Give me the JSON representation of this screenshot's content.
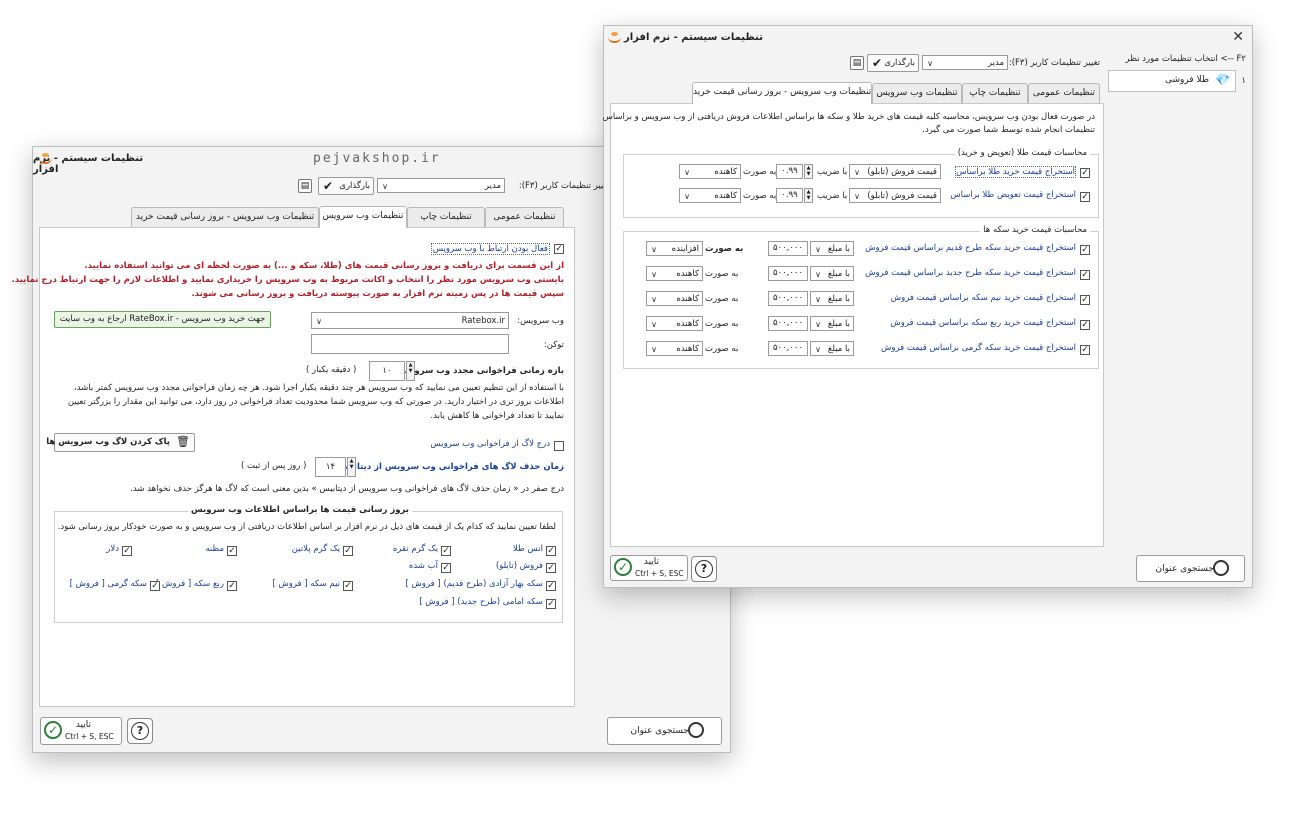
{
  "watermark": "pejvakshop.ir",
  "back": {
    "title": "تنظیمات سیستم - نرم افزار",
    "user_settings_label": "تغییر تنظیمات کاربر (F۳):",
    "user_value": "مدیر",
    "load_label": "بارگذاری",
    "tabs": [
      "تنظیمات عمومی",
      "تنظیمات چاپ",
      "تنظیمات وب سرویس",
      "تنظیمات وب سرویس - بروز رسانی قیمت خرید"
    ],
    "enable_label": "فعال بودن ارتباط با وب سرویس",
    "red_lines": [
      "از این قسمت برای دریافت و بروز رسانی قیمت های (طلا، سکه و ...) به صورت لحظه ای می توانید استفاده نمایید.",
      "بایستی وب سرویس مورد نظر را انتخاب و اکانت مربوط به وب سرویس را خریداری نمایید و اطلاعات لازم را جهت ارتباط درج نمایید.",
      "سپس قیمت ها در پس زمینه نرم افزار به صورت پیوسته دریافت و بروز رسانی می شوند."
    ],
    "webservice_label": "وب سرویس:",
    "webservice_value": "Ratebox.ir",
    "referral_button": "ارجاع به وب سایت RateBox.ir - جهت خرید وب سرویس",
    "token_label": "توکن:",
    "interval_label": "بازه زمانی فراخوانی مجدد وب سرویس:",
    "interval_value": "۱۰",
    "interval_unit": "( دقیقه یکبار )",
    "interval_desc": [
      "با استفاده از این تنظیم تعیین می نمایید که وب سرویس هر چند دقیقه یکبار اجرا شود. هر چه زمان فراخوانی مجدد وب سرویس کمتر باشد،",
      "اطلاعات بروز تری در اختیار دارید. در صورتی که وب سرویس شما محدودیت تعداد فراخوانی در روز دارد، می توانید این مقدار را بزرگتر تعیین",
      "نمایید تا تعداد فراخوانی ها کاهش یابد."
    ],
    "log_label": "درج لاگ از فراخوانی وب سرویس",
    "clear_log_button": "پاک کردن لاگ وب سرویس ها",
    "log_delete_label": "زمان حذف لاگ های فراخوانی وب سرویس از دیتابیس:",
    "log_delete_value": "۱۴",
    "log_delete_unit": "( روز پس از ثبت )",
    "log_delete_desc": "درج صفر در « زمان حذف لاگ های فراخوانی وب سرویس از دیتابیس » بدین معنی است که لاگ ها هرگز حذف نخواهد شد.",
    "group_title": "بروز رسانی قیمت ها براساس اطلاعات وب سرویس",
    "group_desc": "لطفا تعیین نمایید که کدام یک از قیمت های ذیل در نرم افزار بر اساس اطلاعات دریافتی از وب سرویس و به صورت خودکار بروز رسانی شود.",
    "items": [
      "انس طلا",
      "یک گرم نقره",
      "یک گرم پلاتین",
      "مظنه",
      "دلار",
      "فروش (تابلو)",
      "آب شده",
      "سکه بهار آزادی (طرح قدیم) [ فروش ]",
      "نیم سکه [ فروش ]",
      "ربع سکه [ فروش ]",
      "سکه گرمی [ فروش ]",
      "سکه امامی (طرح جدید) [ فروش ]"
    ],
    "search_button": "جستجوی عنوان",
    "ok_label": "تایید",
    "ok_shortcut": "Ctrl + S, ESC",
    "help": "?"
  },
  "front": {
    "title": "تنظیمات سیستم - نرم افزار",
    "left_header": "F۲ --> انتخاب تنظیمات مورد نظر",
    "list_index": "۱",
    "list_item": "طلا فروشی",
    "user_settings_label": "تغییر تنظیمات کاربر (F۳):",
    "user_value": "مدیر",
    "load_label": "بارگذاری",
    "tabs": [
      "تنظیمات عمومی",
      "تنظیمات چاپ",
      "تنظیمات وب سرویس",
      "تنظیمات وب سرویس - بروز رسانی قیمت خرید"
    ],
    "intro": [
      "در صورت فعال بودن وب سرویس، محاسبه کلیه قیمت های خرید طلا و سکه ها براساس اطلاعات فروش دریافتی از وب سرویس و براساس",
      "تنظیمات انجام شده توسط شما صورت می گیرد."
    ],
    "gold_group_title": "محاسبات قیمت طلا (تعویض و خرید)",
    "gold_rows": [
      {
        "label": "استخراج قیمت خرید طلا براساس",
        "source": "قیمت فروش (تابلو)",
        "mult_label": "با ضریب",
        "mult": "۰.۹۹",
        "mode_label": "به صورت",
        "mode": "کاهنده"
      },
      {
        "label": "استخراج قیمت تعویض طلا براساس",
        "source": "قیمت فروش (تابلو)",
        "mult_label": "با ضریب",
        "mult": "۰.۹۹",
        "mode_label": "به صورت",
        "mode": "کاهنده"
      }
    ],
    "coin_group_title": "محاسبات قیمت خرید سکه ها",
    "coin_rows": [
      {
        "label": "استخراج قیمت خرید سکه طرح قدیم براساس قیمت فروش",
        "amt_label": "با مبلغ",
        "amount": "۵۰۰,۰۰۰",
        "mode_label": "به صورت",
        "mode": "افزاینده"
      },
      {
        "label": "استخراج قیمت خرید سکه طرح جدید براساس قیمت فروش",
        "amt_label": "با مبلغ",
        "amount": "۵۰۰,۰۰۰",
        "mode_label": "به صورت",
        "mode": "کاهنده"
      },
      {
        "label": "استخراج قیمت خرید نیم سکه براساس قیمت فروش",
        "amt_label": "با مبلغ",
        "amount": "۵۰۰,۰۰۰",
        "mode_label": "به صورت",
        "mode": "کاهنده"
      },
      {
        "label": "استخراج قیمت خرید ربع سکه براساس قیمت فروش",
        "amt_label": "با مبلغ",
        "amount": "۵۰۰,۰۰۰",
        "mode_label": "به صورت",
        "mode": "کاهنده"
      },
      {
        "label": "استخراج قیمت خرید سکه گرمی براساس قیمت فروش",
        "amt_label": "با مبلغ",
        "amount": "۵۰۰,۰۰۰",
        "mode_label": "به صورت",
        "mode": "کاهنده"
      }
    ],
    "search_button": "جستجوی عنوان",
    "ok_label": "تایید",
    "ok_shortcut": "Ctrl + S, ESC",
    "help": "?",
    "close": "✕"
  },
  "colors": {
    "accent_blue": "#1a3f9a",
    "warn_red": "#b0212a",
    "ok_green": "#2c7d3a"
  }
}
